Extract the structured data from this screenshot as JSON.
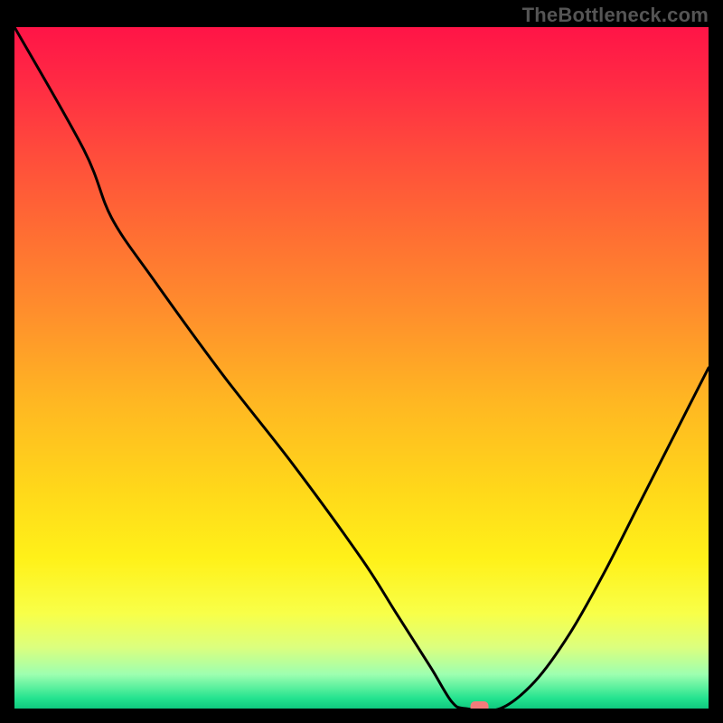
{
  "watermark": "TheBottleneck.com",
  "colors": {
    "gradient_stops": [
      {
        "offset": 0.0,
        "color": "#ff1447"
      },
      {
        "offset": 0.08,
        "color": "#ff2a44"
      },
      {
        "offset": 0.18,
        "color": "#ff4a3c"
      },
      {
        "offset": 0.3,
        "color": "#ff6d33"
      },
      {
        "offset": 0.42,
        "color": "#ff8f2c"
      },
      {
        "offset": 0.55,
        "color": "#ffb722"
      },
      {
        "offset": 0.68,
        "color": "#ffd81a"
      },
      {
        "offset": 0.78,
        "color": "#fff119"
      },
      {
        "offset": 0.86,
        "color": "#f8ff48"
      },
      {
        "offset": 0.91,
        "color": "#dcff7e"
      },
      {
        "offset": 0.95,
        "color": "#9dffb0"
      },
      {
        "offset": 0.985,
        "color": "#24e38f"
      },
      {
        "offset": 1.0,
        "color": "#0fc97f"
      }
    ],
    "curve_stroke": "#000000",
    "marker_fill": "#f47b7b"
  },
  "chart_data": {
    "type": "line",
    "title": "",
    "xlabel": "",
    "ylabel": "",
    "xlim": [
      0,
      100
    ],
    "ylim": [
      0,
      100
    ],
    "legend": false,
    "grid": false,
    "series": [
      {
        "name": "bottleneck_curve",
        "x": [
          0,
          10,
          14,
          20,
          30,
          40,
          50,
          55,
          60,
          63,
          65,
          70,
          75,
          80,
          85,
          90,
          95,
          100
        ],
        "values": [
          100,
          82,
          72,
          63,
          49,
          36,
          22,
          14,
          6,
          1,
          0,
          0,
          4,
          11,
          20,
          30,
          40,
          50
        ]
      }
    ],
    "annotations": [
      {
        "name": "optimal_marker",
        "x": 67,
        "y": 0,
        "shape": "pill"
      }
    ]
  }
}
